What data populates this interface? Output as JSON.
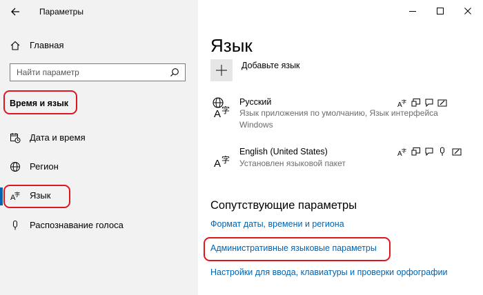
{
  "window": {
    "title": "Параметры",
    "minimize_icon": "minimize-icon",
    "maximize_icon": "maximize-icon",
    "close_icon": "close-icon"
  },
  "sidebar": {
    "home_label": "Главная",
    "search_placeholder": "Найти параметр",
    "section_heading": "Время и язык",
    "items": [
      {
        "label": "Дата и время",
        "icon": "calendar-clock-icon"
      },
      {
        "label": "Регион",
        "icon": "globe-icon"
      },
      {
        "label": "Язык",
        "icon": "language-icon"
      },
      {
        "label": "Распознавание голоса",
        "icon": "microphone-icon"
      }
    ]
  },
  "main": {
    "title": "Язык",
    "add_language_label": "Добавьте язык",
    "languages": [
      {
        "name": "Русский",
        "description_line1": "Язык приложения по умолчанию, Язык интерфейса",
        "description_line2": "Windows",
        "features": [
          "language-pack-icon",
          "display-icon",
          "speech-icon",
          "handwriting-icon"
        ]
      },
      {
        "name": "English (United States)",
        "description_line1": "Установлен языковой пакет",
        "features": [
          "language-pack-icon",
          "display-icon",
          "speech-icon",
          "microphone-feature-icon",
          "handwriting-icon"
        ]
      }
    ],
    "related": {
      "heading": "Сопутствующие параметры",
      "links": [
        "Формат даты, времени и региона",
        "Административные языковые параметры",
        "Настройки для ввода, клавиатуры и проверки орфографии"
      ]
    }
  },
  "colors": {
    "accent": "#0063b1",
    "highlight": "#e0141e",
    "sidebar_bg": "#f2f2f2"
  }
}
